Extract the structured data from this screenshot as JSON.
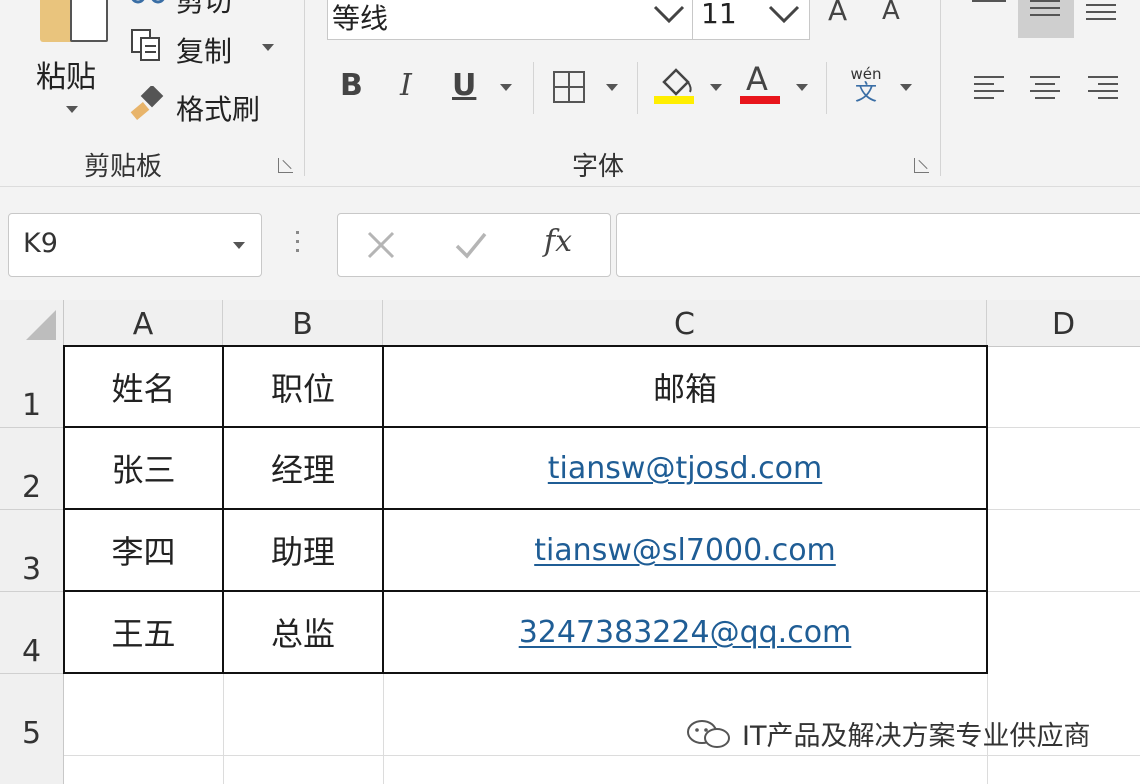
{
  "ribbon": {
    "clipboard": {
      "paste_label": "粘贴",
      "cut_label": "剪切",
      "copy_label": "复制",
      "format_painter_label": "格式刷",
      "group_label": "剪贴板"
    },
    "font": {
      "font_name": "等线",
      "font_size": "11",
      "bold_label": "B",
      "italic_label": "I",
      "underline_label": "U",
      "font_color_label": "A",
      "phonetic_top": "wén",
      "phonetic_bottom": "文",
      "group_label": "字体",
      "fill_color": "#ffee00",
      "font_color": "#e8141b"
    }
  },
  "formula_bar": {
    "name_box": "K9",
    "fx_label": "fx",
    "formula": ""
  },
  "sheet": {
    "columns": [
      "A",
      "B",
      "C",
      "D"
    ],
    "rows": [
      "1",
      "2",
      "3",
      "4",
      "5"
    ],
    "table": [
      [
        "姓名",
        "职位",
        "邮箱"
      ],
      [
        "张三",
        "经理",
        "tiansw@tjosd.com"
      ],
      [
        "李四",
        "助理",
        "tiansw@sl7000.com"
      ],
      [
        "王五",
        "总监",
        "3247383224@qq.com"
      ]
    ],
    "link_color": "#1f5d95"
  },
  "watermark": {
    "text": "IT产品及解决方案专业供应商",
    "icon": "wechat-icon"
  }
}
